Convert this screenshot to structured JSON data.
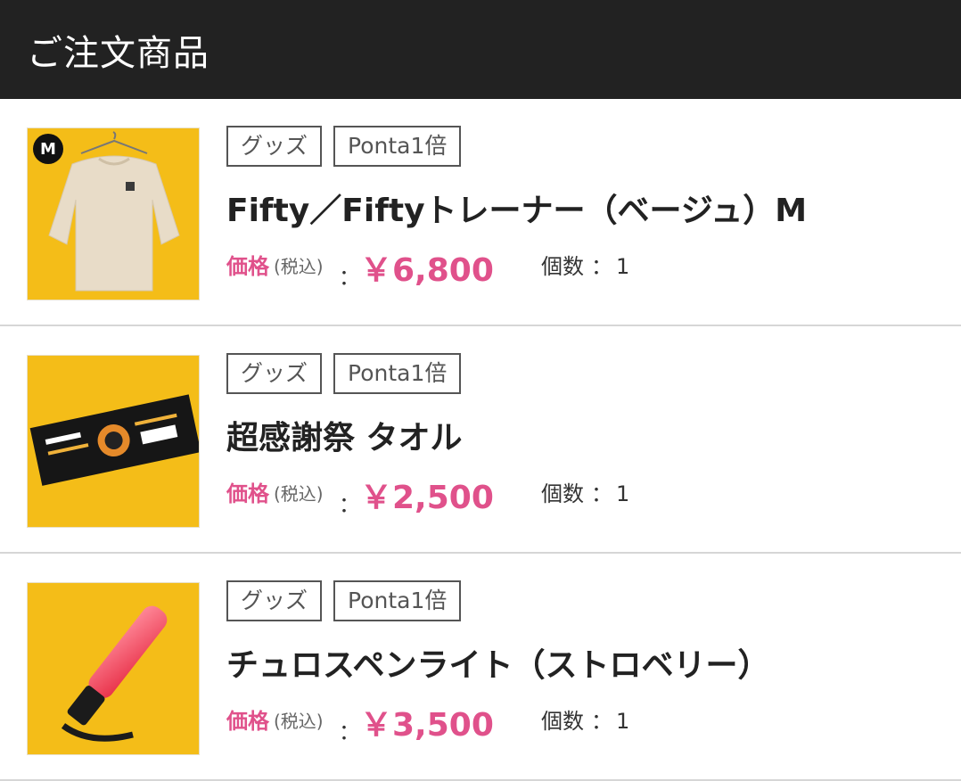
{
  "header": {
    "title": "ご注文商品"
  },
  "items": [
    {
      "tags": [
        "グッズ",
        "Ponta1倍"
      ],
      "name": "Fifty／Fiftyトレーナー（ベージュ）M",
      "price_label": "価格",
      "price_tax": "(税込)",
      "price_colon": "：",
      "price": "￥6,800",
      "qty_label": "個数",
      "qty_colon": "：",
      "qty": "1",
      "image_badge": "M"
    },
    {
      "tags": [
        "グッズ",
        "Ponta1倍"
      ],
      "name": "超感謝祭 タオル",
      "price_label": "価格",
      "price_tax": "(税込)",
      "price_colon": "：",
      "price": "￥2,500",
      "qty_label": "個数",
      "qty_colon": "：",
      "qty": "1"
    },
    {
      "tags": [
        "グッズ",
        "Ponta1倍"
      ],
      "name": "チュロスペンライト（ストロベリー）",
      "price_label": "価格",
      "price_tax": "(税込)",
      "price_colon": "：",
      "price": "￥3,500",
      "qty_label": "個数",
      "qty_colon": "：",
      "qty": "1"
    }
  ],
  "colors": {
    "header_bg": "#222222",
    "accent": "#e0518b",
    "image_bg": "#f5c117"
  }
}
